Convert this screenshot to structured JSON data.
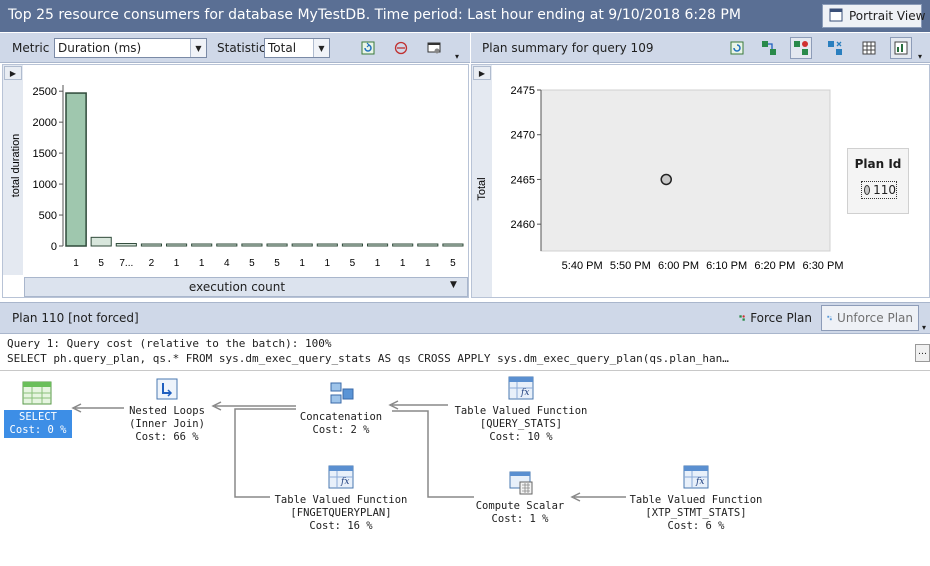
{
  "window": {
    "title": "Top 25 resource consumers for database MyTestDB. Time period: Last hour ending at 9/10/2018 6:28 PM",
    "portrait_view_label": "Portrait View"
  },
  "left_toolbar": {
    "metric_label": "Metric",
    "metric_value": "Duration (ms)",
    "statistic_label": "Statistic",
    "statistic_value": "Total"
  },
  "right_toolbar": {
    "title": "Plan summary for query 109"
  },
  "colors": {
    "titlebar": "#5a6f94",
    "toolbar": "#cfd8e8",
    "bar_fill": "#9fc7ae",
    "selected_node": "#3d8ee6"
  },
  "chart_data": [
    {
      "type": "bar",
      "ylabel": "total duration",
      "xlabel": "execution count",
      "ylim": [
        0,
        2600
      ],
      "yticks": [
        "0",
        "500",
        "1000",
        "1500",
        "2000",
        "2500"
      ],
      "ytick_values": [
        0,
        500,
        1000,
        1500,
        2000,
        2500
      ],
      "categories": [
        "1",
        "5",
        "7...",
        "2",
        "1",
        "1",
        "4",
        "5",
        "5",
        "1",
        "1",
        "5",
        "1",
        "1",
        "1",
        "5"
      ],
      "values": [
        2470,
        140,
        40,
        30,
        18,
        8,
        8,
        8,
        8,
        8,
        8,
        8,
        8,
        8,
        8,
        8
      ],
      "grid": false
    },
    {
      "type": "scatter",
      "ylabel": "Total",
      "ylim": [
        2457,
        2475
      ],
      "yticks": [
        "2460",
        "2465",
        "2470",
        "2475"
      ],
      "ytick_values": [
        2460,
        2465,
        2470,
        2475
      ],
      "xticks": [
        "5:40 PM",
        "5:50 PM",
        "6:00 PM",
        "6:10 PM",
        "6:20 PM",
        "6:30 PM"
      ],
      "xlim": [
        0,
        60
      ],
      "xtick_values": [
        10,
        20,
        30,
        40,
        50,
        60
      ],
      "points": [
        {
          "x": 26,
          "y": 2465
        }
      ],
      "legend_title": "Plan Id",
      "legend_entry": "110",
      "legend_placement": "right"
    }
  ],
  "plan_bar": {
    "title": "Plan 110 [not forced]",
    "force_label": "Force Plan",
    "unforce_label": "Unforce Plan"
  },
  "query": {
    "line1": "Query 1: Query cost (relative to the batch): 100%",
    "line2": "SELECT ph.query_plan, qs.* FROM sys.dm_exec_query_stats AS qs CROSS APPLY sys.dm_exec_query_plan(qs.plan_han…"
  },
  "plan_nodes": {
    "select": {
      "l1": "SELECT",
      "l2": "Cost: 0 %"
    },
    "nested_loops": {
      "l1": "Nested Loops",
      "l2": "(Inner Join)",
      "l3": "Cost: 66 %"
    },
    "concatenation": {
      "l1": "Concatenation",
      "l2": "Cost: 2 %"
    },
    "tvf_query_stats": {
      "l1": "Table Valued Function",
      "l2": "[QUERY_STATS]",
      "l3": "Cost: 10 %"
    },
    "tvf_fngetqueryplan": {
      "l1": "Table Valued Function",
      "l2": "[FNGETQUERYPLAN]",
      "l3": "Cost: 16 %"
    },
    "compute_scalar": {
      "l1": "Compute Scalar",
      "l2": "Cost: 1 %"
    },
    "tvf_xtp_stmt_stats": {
      "l1": "Table Valued Function",
      "l2": "[XTP_STMT_STATS]",
      "l3": "Cost: 6 %"
    }
  }
}
